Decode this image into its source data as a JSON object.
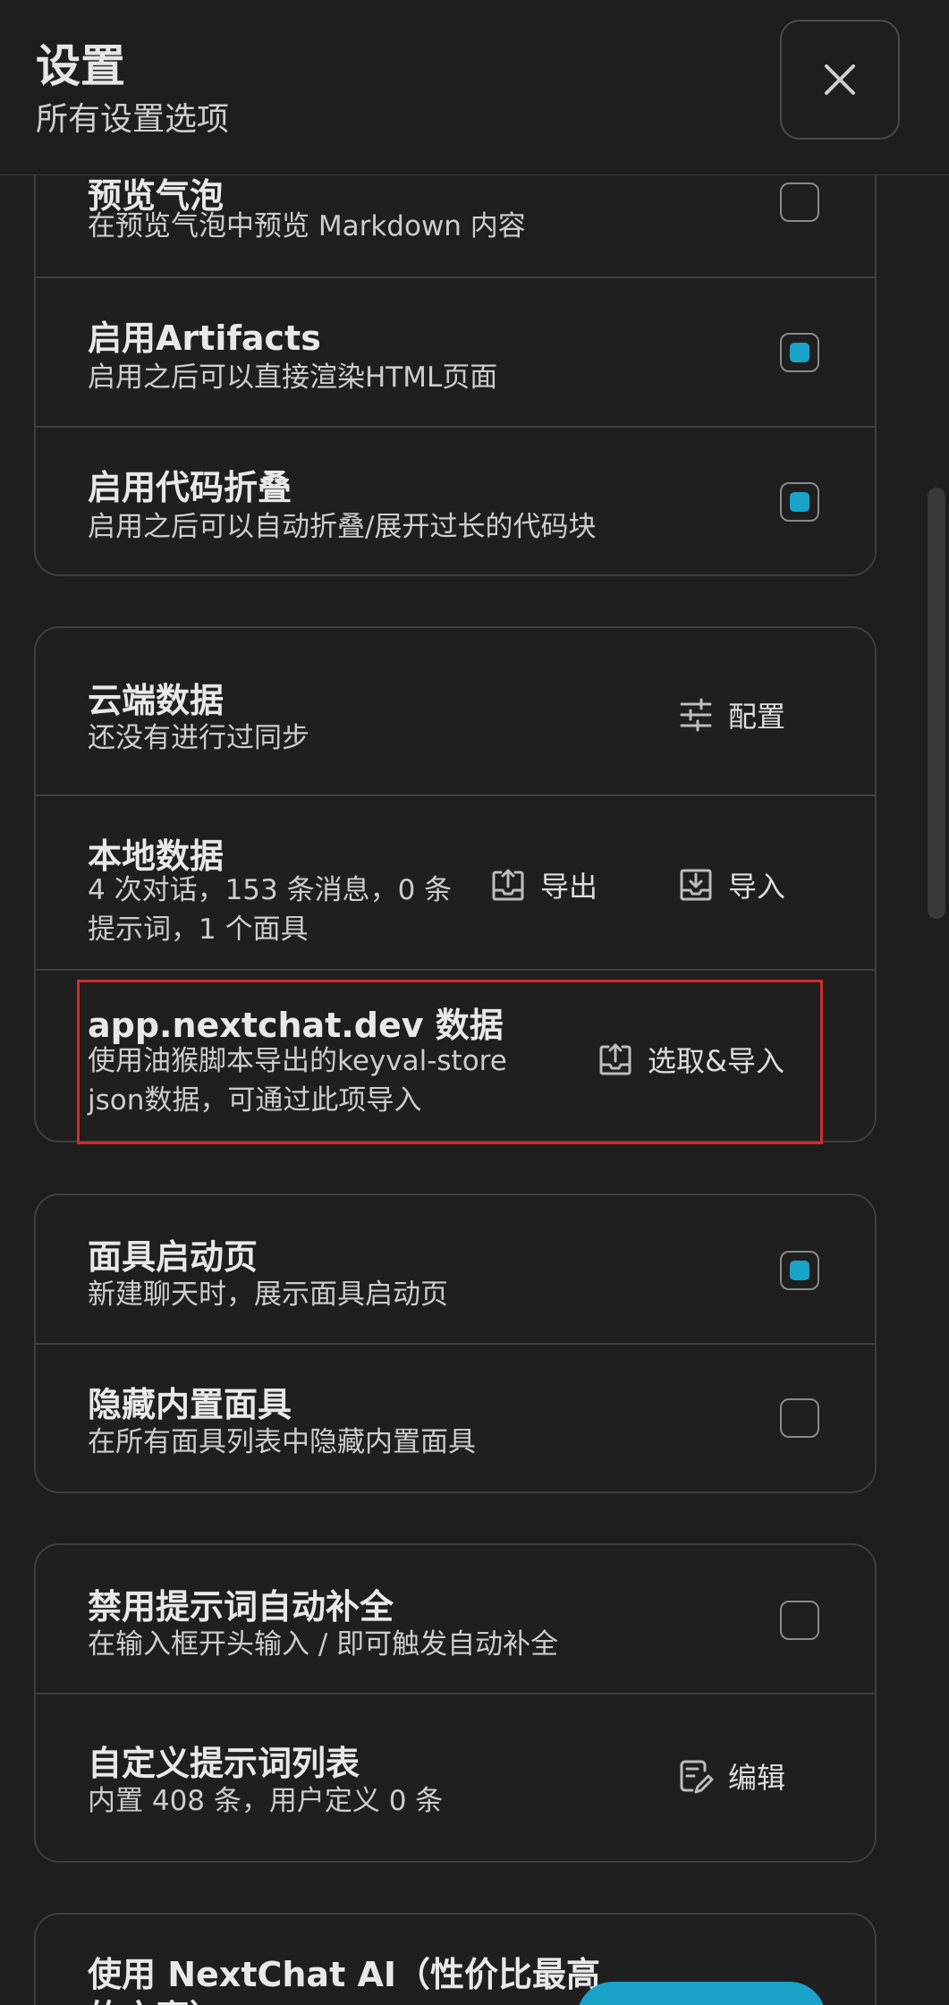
{
  "header": {
    "title": "设置",
    "subtitle": "所有设置选项"
  },
  "groups": [
    {
      "items": [
        {
          "title": "预览气泡",
          "desc": "在预览气泡中预览 Markdown 内容",
          "checked": false
        },
        {
          "title": "启用Artifacts",
          "desc": "启用之后可以直接渲染HTML页面",
          "checked": true
        },
        {
          "title": "启用代码折叠",
          "desc": "启用之后可以自动折叠/展开过长的代码块",
          "checked": true
        }
      ]
    },
    {
      "items": [
        {
          "title": "云端数据",
          "desc": "还没有进行过同步",
          "button": "配置",
          "icon": "sliders-icon"
        },
        {
          "title": "本地数据",
          "desc_line1": "4 次对话，153 条消息，0 条",
          "desc_line2": "提示词，1 个面具",
          "export_button": "导出",
          "import_button": "导入",
          "export_icon": "upload-tray-icon",
          "import_icon": "download-tray-icon"
        },
        {
          "title": "app.nextchat.dev 数据",
          "desc_line1": "使用油猴脚本导出的keyval-store",
          "desc_line2": "json数据，可通过此项导入",
          "button": "选取&导入",
          "icon": "upload-tray-icon"
        }
      ]
    },
    {
      "items": [
        {
          "title": "面具启动页",
          "desc": "新建聊天时，展示面具启动页",
          "checked": true
        },
        {
          "title": "隐藏内置面具",
          "desc": "在所有面具列表中隐藏内置面具",
          "checked": false
        }
      ]
    },
    {
      "items": [
        {
          "title": "禁用提示词自动补全",
          "desc": "在输入框开头输入 / 即可触发自动补全",
          "checked": false
        },
        {
          "title": "自定义提示词列表",
          "desc": "内置 408 条，用户定义 0 条",
          "button": "编辑",
          "icon": "edit-icon"
        }
      ]
    },
    {
      "items": [
        {
          "title_line1": "使用 NextChat AI（性价比最高",
          "title_line2": "的方案）"
        }
      ]
    }
  ],
  "colors": {
    "accent": "#1aa3c9",
    "highlight": "#d42a2a",
    "background": "#1e1e1e",
    "border": "#3e3e3e"
  }
}
